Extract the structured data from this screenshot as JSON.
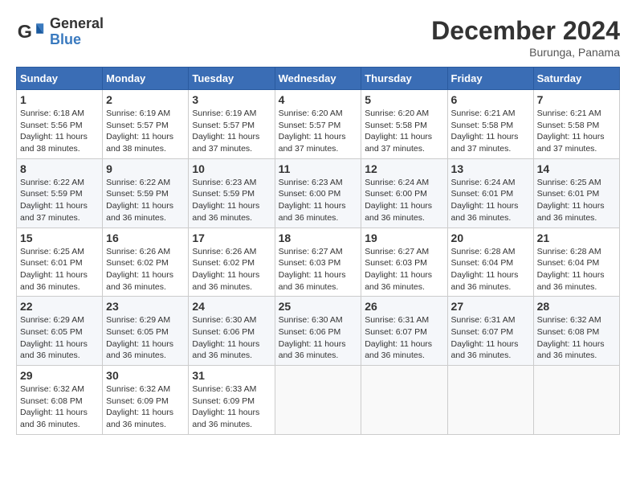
{
  "header": {
    "logo_line1": "General",
    "logo_line2": "Blue",
    "month_title": "December 2024",
    "location": "Burunga, Panama"
  },
  "weekdays": [
    "Sunday",
    "Monday",
    "Tuesday",
    "Wednesday",
    "Thursday",
    "Friday",
    "Saturday"
  ],
  "weeks": [
    [
      {
        "day": "1",
        "sunrise": "6:18 AM",
        "sunset": "5:56 PM",
        "daylight": "11 hours and 38 minutes."
      },
      {
        "day": "2",
        "sunrise": "6:19 AM",
        "sunset": "5:57 PM",
        "daylight": "11 hours and 38 minutes."
      },
      {
        "day": "3",
        "sunrise": "6:19 AM",
        "sunset": "5:57 PM",
        "daylight": "11 hours and 37 minutes."
      },
      {
        "day": "4",
        "sunrise": "6:20 AM",
        "sunset": "5:57 PM",
        "daylight": "11 hours and 37 minutes."
      },
      {
        "day": "5",
        "sunrise": "6:20 AM",
        "sunset": "5:58 PM",
        "daylight": "11 hours and 37 minutes."
      },
      {
        "day": "6",
        "sunrise": "6:21 AM",
        "sunset": "5:58 PM",
        "daylight": "11 hours and 37 minutes."
      },
      {
        "day": "7",
        "sunrise": "6:21 AM",
        "sunset": "5:58 PM",
        "daylight": "11 hours and 37 minutes."
      }
    ],
    [
      {
        "day": "8",
        "sunrise": "6:22 AM",
        "sunset": "5:59 PM",
        "daylight": "11 hours and 37 minutes."
      },
      {
        "day": "9",
        "sunrise": "6:22 AM",
        "sunset": "5:59 PM",
        "daylight": "11 hours and 36 minutes."
      },
      {
        "day": "10",
        "sunrise": "6:23 AM",
        "sunset": "5:59 PM",
        "daylight": "11 hours and 36 minutes."
      },
      {
        "day": "11",
        "sunrise": "6:23 AM",
        "sunset": "6:00 PM",
        "daylight": "11 hours and 36 minutes."
      },
      {
        "day": "12",
        "sunrise": "6:24 AM",
        "sunset": "6:00 PM",
        "daylight": "11 hours and 36 minutes."
      },
      {
        "day": "13",
        "sunrise": "6:24 AM",
        "sunset": "6:01 PM",
        "daylight": "11 hours and 36 minutes."
      },
      {
        "day": "14",
        "sunrise": "6:25 AM",
        "sunset": "6:01 PM",
        "daylight": "11 hours and 36 minutes."
      }
    ],
    [
      {
        "day": "15",
        "sunrise": "6:25 AM",
        "sunset": "6:01 PM",
        "daylight": "11 hours and 36 minutes."
      },
      {
        "day": "16",
        "sunrise": "6:26 AM",
        "sunset": "6:02 PM",
        "daylight": "11 hours and 36 minutes."
      },
      {
        "day": "17",
        "sunrise": "6:26 AM",
        "sunset": "6:02 PM",
        "daylight": "11 hours and 36 minutes."
      },
      {
        "day": "18",
        "sunrise": "6:27 AM",
        "sunset": "6:03 PM",
        "daylight": "11 hours and 36 minutes."
      },
      {
        "day": "19",
        "sunrise": "6:27 AM",
        "sunset": "6:03 PM",
        "daylight": "11 hours and 36 minutes."
      },
      {
        "day": "20",
        "sunrise": "6:28 AM",
        "sunset": "6:04 PM",
        "daylight": "11 hours and 36 minutes."
      },
      {
        "day": "21",
        "sunrise": "6:28 AM",
        "sunset": "6:04 PM",
        "daylight": "11 hours and 36 minutes."
      }
    ],
    [
      {
        "day": "22",
        "sunrise": "6:29 AM",
        "sunset": "6:05 PM",
        "daylight": "11 hours and 36 minutes."
      },
      {
        "day": "23",
        "sunrise": "6:29 AM",
        "sunset": "6:05 PM",
        "daylight": "11 hours and 36 minutes."
      },
      {
        "day": "24",
        "sunrise": "6:30 AM",
        "sunset": "6:06 PM",
        "daylight": "11 hours and 36 minutes."
      },
      {
        "day": "25",
        "sunrise": "6:30 AM",
        "sunset": "6:06 PM",
        "daylight": "11 hours and 36 minutes."
      },
      {
        "day": "26",
        "sunrise": "6:31 AM",
        "sunset": "6:07 PM",
        "daylight": "11 hours and 36 minutes."
      },
      {
        "day": "27",
        "sunrise": "6:31 AM",
        "sunset": "6:07 PM",
        "daylight": "11 hours and 36 minutes."
      },
      {
        "day": "28",
        "sunrise": "6:32 AM",
        "sunset": "6:08 PM",
        "daylight": "11 hours and 36 minutes."
      }
    ],
    [
      {
        "day": "29",
        "sunrise": "6:32 AM",
        "sunset": "6:08 PM",
        "daylight": "11 hours and 36 minutes."
      },
      {
        "day": "30",
        "sunrise": "6:32 AM",
        "sunset": "6:09 PM",
        "daylight": "11 hours and 36 minutes."
      },
      {
        "day": "31",
        "sunrise": "6:33 AM",
        "sunset": "6:09 PM",
        "daylight": "11 hours and 36 minutes."
      },
      null,
      null,
      null,
      null
    ]
  ]
}
